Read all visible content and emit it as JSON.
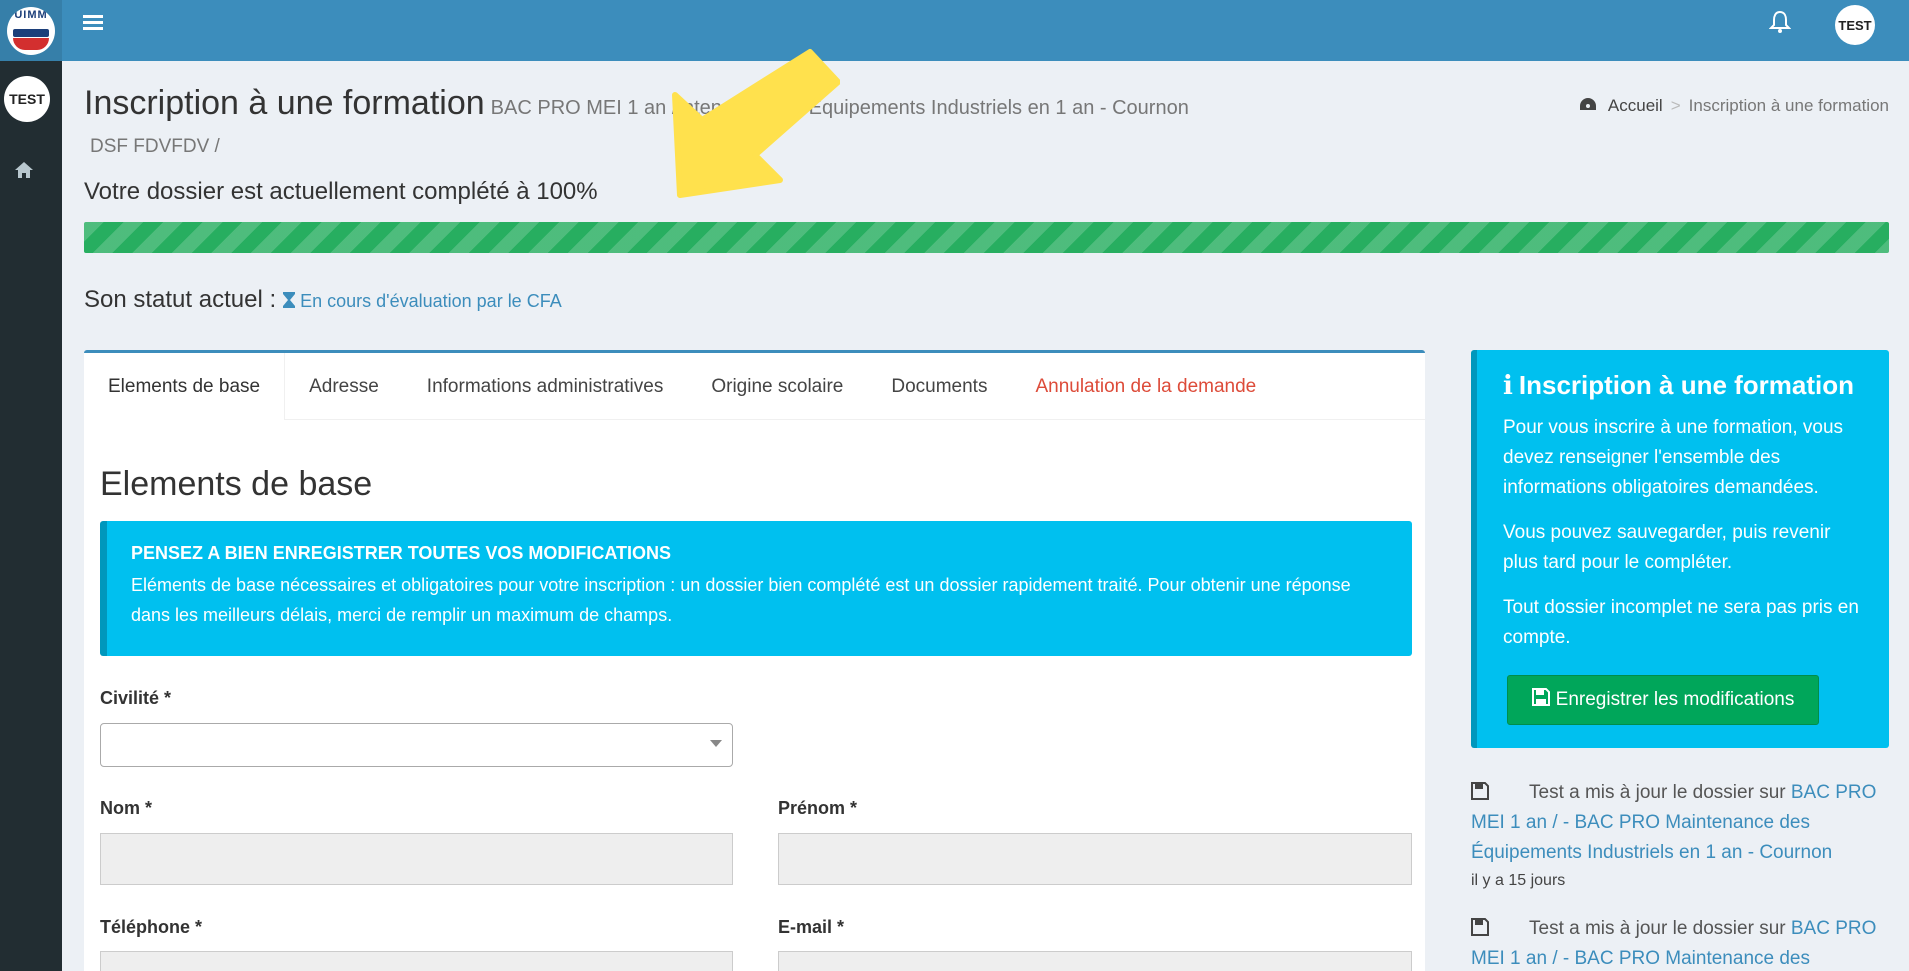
{
  "sidebar": {
    "logo_text": "UIMM",
    "user_initials": "TEST"
  },
  "topbar": {
    "user_initials": "TEST"
  },
  "header": {
    "title": "Inscription à une formation",
    "subtitle": "BAC PRO MEI 1 an /         ntenance des Équipements Industriels en 1 an - Cournon",
    "subtitle2": "DSF FDVFDV /",
    "breadcrumb_home": "Accueil",
    "breadcrumb_current": "Inscription à une formation"
  },
  "progress": {
    "text": "Votre dossier est actuellement complété à 100%",
    "percent": 100
  },
  "status": {
    "label": "Son statut actuel :",
    "value": "En cours d'évaluation par le CFA"
  },
  "tabs": [
    {
      "label": "Elements de base"
    },
    {
      "label": "Adresse"
    },
    {
      "label": "Informations administratives"
    },
    {
      "label": "Origine scolaire"
    },
    {
      "label": "Documents"
    },
    {
      "label": "Annulation de la demande"
    }
  ],
  "form": {
    "section_title": "Elements de base",
    "callout_title": "PENSEZ A BIEN ENREGISTRER TOUTES VOS MODIFICATIONS",
    "callout_text": "Eléments de base nécessaires et obligatoires pour votre inscription : un dossier bien complété est un dossier rapidement traité. Pour obtenir une réponse dans les meilleurs délais, merci de remplir un maximum de champs.",
    "civilite_label": "Civilité *",
    "nom_label": "Nom *",
    "prenom_label": "Prénom *",
    "telephone_label": "Téléphone *",
    "email_label": "E-mail *"
  },
  "infobox": {
    "title": "Inscription à une formation",
    "p1": "Pour vous inscrire à une formation, vous devez renseigner l'ensemble des informations obligatoires demandées.",
    "p2": "Vous pouvez sauvegarder, puis revenir plus tard pour le compléter.",
    "p3": "Tout dossier incomplet ne sera pas pris en compte.",
    "save_label": "Enregistrer les modifications"
  },
  "activity": [
    {
      "text": "Test a mis à jour le dossier sur",
      "link": "BAC PRO MEI 1 an / - BAC PRO Maintenance des Équipements Industriels en 1 an - Cournon",
      "time": "il y a 15 jours"
    },
    {
      "text": "Test a mis à jour le dossier sur",
      "link": "BAC PRO MEI 1 an / - BAC PRO Maintenance des",
      "time": ""
    }
  ],
  "colors": {
    "topbar": "#3c8dbc",
    "sidebar": "#222d32",
    "progress": "#27ae60",
    "info": "#00c0ef",
    "success": "#00a65a",
    "danger": "#dd4b39",
    "annotation_arrow": "#ffe14d"
  }
}
